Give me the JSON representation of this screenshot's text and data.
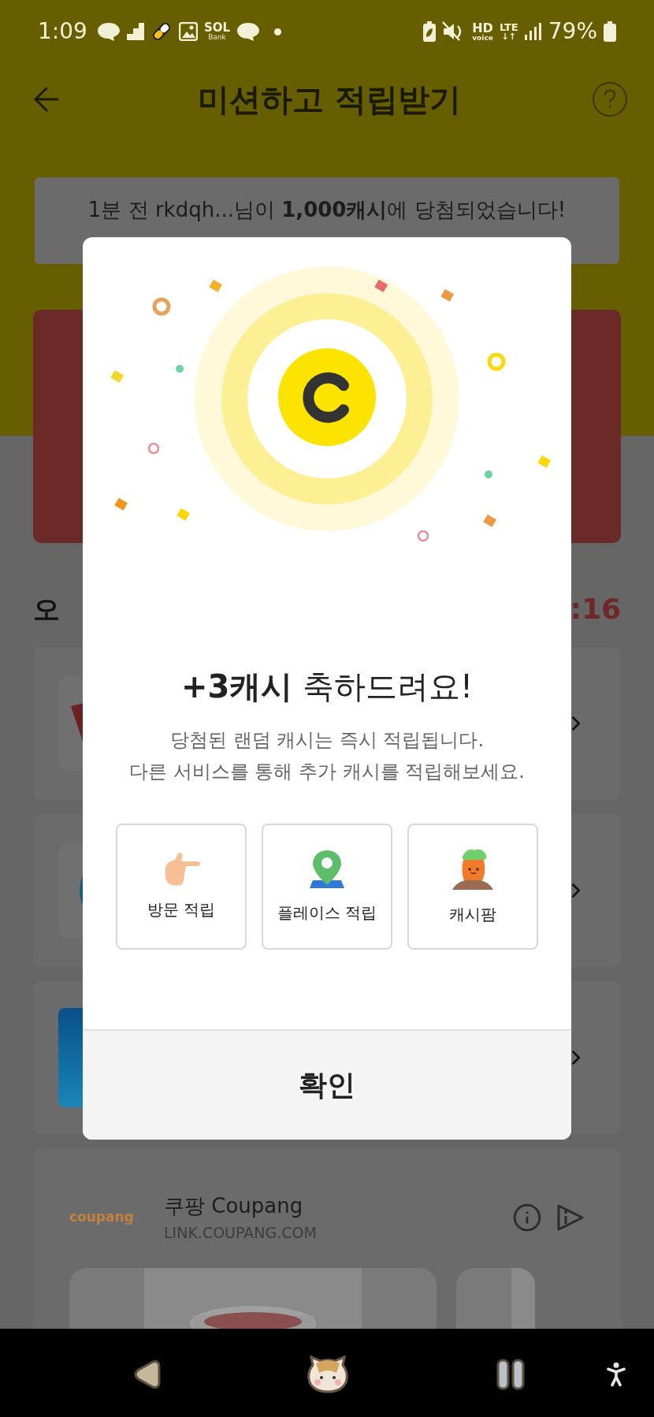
{
  "status_bar": {
    "time": "1:09",
    "sol_logo": "SOL",
    "sol_caption": "Bank",
    "hd": "HD",
    "voice": "voice",
    "lte": "LTE",
    "lte_arrows": "↓↑",
    "battery": "79%"
  },
  "header": {
    "title": "미션하고 적립받기"
  },
  "ticker": {
    "text": "1분 전 rkdqh...님이 **1,000캐시**에 당첨되었습니다!"
  },
  "section": {
    "title_fragment": "오",
    "timer_fragment": ":16"
  },
  "missions": [
    {
      "kind": "ticket"
    },
    {
      "kind": "circle"
    },
    {
      "kind": "logo"
    }
  ],
  "ad_card": {
    "logo": "coupang",
    "name": "쿠팡 Coupang",
    "url": "LINK.COUPANG.COM"
  },
  "dialog": {
    "headline": "**+3캐시** 축하드려요!",
    "message": [
      "당첨된 랜덤 캐시는 즉시 적립됩니다.",
      "다른 서비스를 통해 추가 캐시를 적립해보세요."
    ],
    "shortcuts": [
      {
        "kind": "visit",
        "label": "방문 적립"
      },
      {
        "kind": "place",
        "label": "플레이스 적립"
      },
      {
        "kind": "farm",
        "label": "캐시팜"
      }
    ],
    "confirm": "확인"
  }
}
